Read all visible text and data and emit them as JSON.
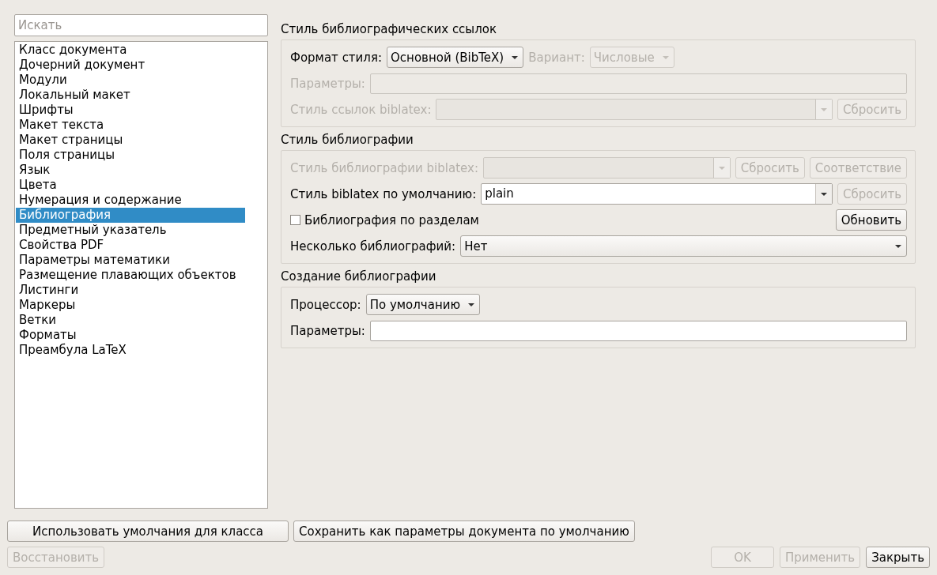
{
  "search": {
    "placeholder": "Искать"
  },
  "sidebar": {
    "items": [
      {
        "label": "Класс документа",
        "selected": false
      },
      {
        "label": "Дочерний документ",
        "selected": false
      },
      {
        "label": "Модули",
        "selected": false
      },
      {
        "label": "Локальный макет",
        "selected": false
      },
      {
        "label": "Шрифты",
        "selected": false
      },
      {
        "label": "Макет текста",
        "selected": false
      },
      {
        "label": "Макет страницы",
        "selected": false
      },
      {
        "label": "Поля страницы",
        "selected": false
      },
      {
        "label": "Язык",
        "selected": false
      },
      {
        "label": "Цвета",
        "selected": false
      },
      {
        "label": "Нумерация и содержание",
        "selected": false
      },
      {
        "label": "Библиография",
        "selected": true
      },
      {
        "label": "Предметный указатель",
        "selected": false
      },
      {
        "label": "Свойства PDF",
        "selected": false
      },
      {
        "label": "Параметры математики",
        "selected": false
      },
      {
        "label": "Размещение плавающих объектов",
        "selected": false
      },
      {
        "label": "Листинги",
        "selected": false
      },
      {
        "label": "Маркеры",
        "selected": false
      },
      {
        "label": "Ветки",
        "selected": false
      },
      {
        "label": "Форматы",
        "selected": false
      },
      {
        "label": "Преамбула LaTeX",
        "selected": false
      }
    ]
  },
  "sections": [
    {
      "title": "Стиль библиографических ссылок",
      "rows": [
        {
          "widgets": [
            {
              "kind": "label",
              "text": "Формат стиля:",
              "disabled": false
            },
            {
              "kind": "combo",
              "value": "Основной (BibTeX)",
              "disabled": false
            },
            {
              "kind": "label",
              "text": "Вариант:",
              "disabled": true
            },
            {
              "kind": "combo",
              "value": "Числовые",
              "disabled": true
            }
          ]
        },
        {
          "widgets": [
            {
              "kind": "label",
              "text": "Параметры:",
              "disabled": true
            },
            {
              "kind": "field",
              "disabled": true
            }
          ]
        },
        {
          "widgets": [
            {
              "kind": "label",
              "text": "Стиль ссылок biblatex:",
              "disabled": true
            },
            {
              "kind": "editable_combo",
              "disabled": true
            },
            {
              "kind": "button",
              "label": "Сбросить",
              "disabled": true
            }
          ]
        }
      ]
    },
    {
      "title": "Стиль библиографии",
      "rows": [
        {
          "widgets": [
            {
              "kind": "label",
              "text": "Стиль библиографии biblatex:",
              "disabled": true
            },
            {
              "kind": "editable_combo",
              "disabled": true
            },
            {
              "kind": "button",
              "label": "Сбросить",
              "disabled": true
            },
            {
              "kind": "button",
              "label": "Соответствие",
              "disabled": true
            }
          ]
        },
        {
          "widgets": [
            {
              "kind": "label",
              "text": "Стиль biblatex по умолчанию:",
              "disabled": false
            },
            {
              "kind": "editable_combo",
              "value": "plain",
              "disabled": false
            },
            {
              "kind": "button",
              "label": "Сбросить",
              "disabled": true
            }
          ]
        },
        {
          "widgets": [
            {
              "kind": "checkbox",
              "label": "Библиография по разделам",
              "checked": false
            },
            {
              "kind": "button",
              "label": "Обновить",
              "disabled": false
            }
          ]
        },
        {
          "widgets": [
            {
              "kind": "label",
              "text": "Несколько библиографий:",
              "disabled": false
            },
            {
              "kind": "wide_combo",
              "value": "Нет",
              "disabled": false
            }
          ]
        }
      ]
    },
    {
      "title": "Создание библиографии",
      "rows": [
        {
          "widgets": [
            {
              "kind": "label",
              "text": "Процессор:",
              "disabled": false
            },
            {
              "kind": "combo",
              "value": "По умолчанию",
              "disabled": false
            }
          ]
        },
        {
          "widgets": [
            {
              "kind": "label",
              "text": "Параметры:",
              "disabled": false
            },
            {
              "kind": "field",
              "disabled": false
            }
          ]
        }
      ]
    }
  ],
  "bottom_buttons": [
    {
      "label": "Использовать умолчания для класса",
      "disabled": false
    },
    {
      "label": "Сохранить как параметры документа по умолчанию",
      "disabled": false
    }
  ],
  "footer": {
    "left": [
      {
        "label": "Восстановить",
        "disabled": true
      }
    ],
    "right": [
      {
        "label": "OK",
        "disabled": true
      },
      {
        "label": "Применить",
        "disabled": true
      },
      {
        "label": "Закрыть",
        "disabled": false
      }
    ]
  }
}
